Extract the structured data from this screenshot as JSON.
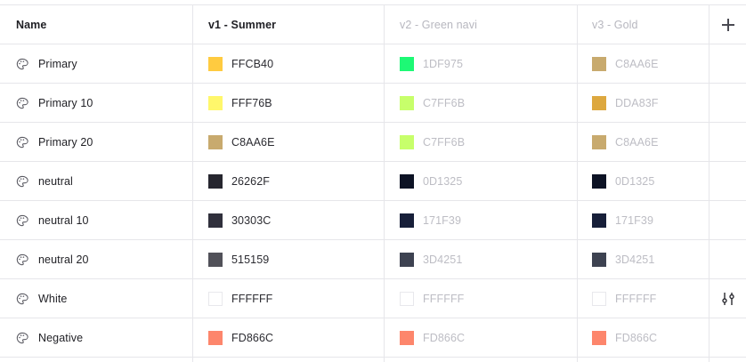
{
  "columns": {
    "name": "Name",
    "v1": "v1 - Summer",
    "v2": "v2 - Green navi",
    "v3": "v3 - Gold"
  },
  "icons": {
    "add": "plus-icon",
    "row_icon": "palette-icon",
    "row_action": "sliders-icon"
  },
  "rows": [
    {
      "name": "Primary",
      "v1": "FFCB40",
      "v2": "1DF975",
      "v3": "C8AA6E",
      "v1_color": "#FFCB40",
      "v2_color": "#1DF975",
      "v3_color": "#C8AA6E"
    },
    {
      "name": "Primary 10",
      "v1": "FFF76B",
      "v2": "C7FF6B",
      "v3": "DDA83F",
      "v1_color": "#FFF76B",
      "v2_color": "#C7FF6B",
      "v3_color": "#DDA83F"
    },
    {
      "name": "Primary 20",
      "v1": "C8AA6E",
      "v2": "C7FF6B",
      "v3": "C8AA6E",
      "v1_color": "#C8AA6E",
      "v2_color": "#C7FF6B",
      "v3_color": "#C8AA6E"
    },
    {
      "name": "neutral",
      "v1": "26262F",
      "v2": "0D1325",
      "v3": "0D1325",
      "v1_color": "#26262F",
      "v2_color": "#0D1325",
      "v3_color": "#0D1325"
    },
    {
      "name": "neutral 10",
      "v1": "30303C",
      "v2": "171F39",
      "v3": "171F39",
      "v1_color": "#30303C",
      "v2_color": "#171F39",
      "v3_color": "#171F39"
    },
    {
      "name": "neutral 20",
      "v1": "515159",
      "v2": "3D4251",
      "v3": "3D4251",
      "v1_color": "#515159",
      "v2_color": "#3D4251",
      "v3_color": "#3D4251"
    },
    {
      "name": "White",
      "v1": "FFFFFF",
      "v2": "FFFFFF",
      "v3": "FFFFFF",
      "v1_color": "#FFFFFF",
      "v2_color": "#FFFFFF",
      "v3_color": "#FFFFFF"
    },
    {
      "name": "Negative",
      "v1": "FD866C",
      "v2": "FD866C",
      "v3": "FD866C",
      "v1_color": "#FD866C",
      "v2_color": "#FD866C",
      "v3_color": "#FD866C"
    }
  ],
  "colors": {
    "grid_line": "#e6e6ea",
    "active_text": "#1f1f24",
    "muted_text": "#b7b7bf"
  }
}
